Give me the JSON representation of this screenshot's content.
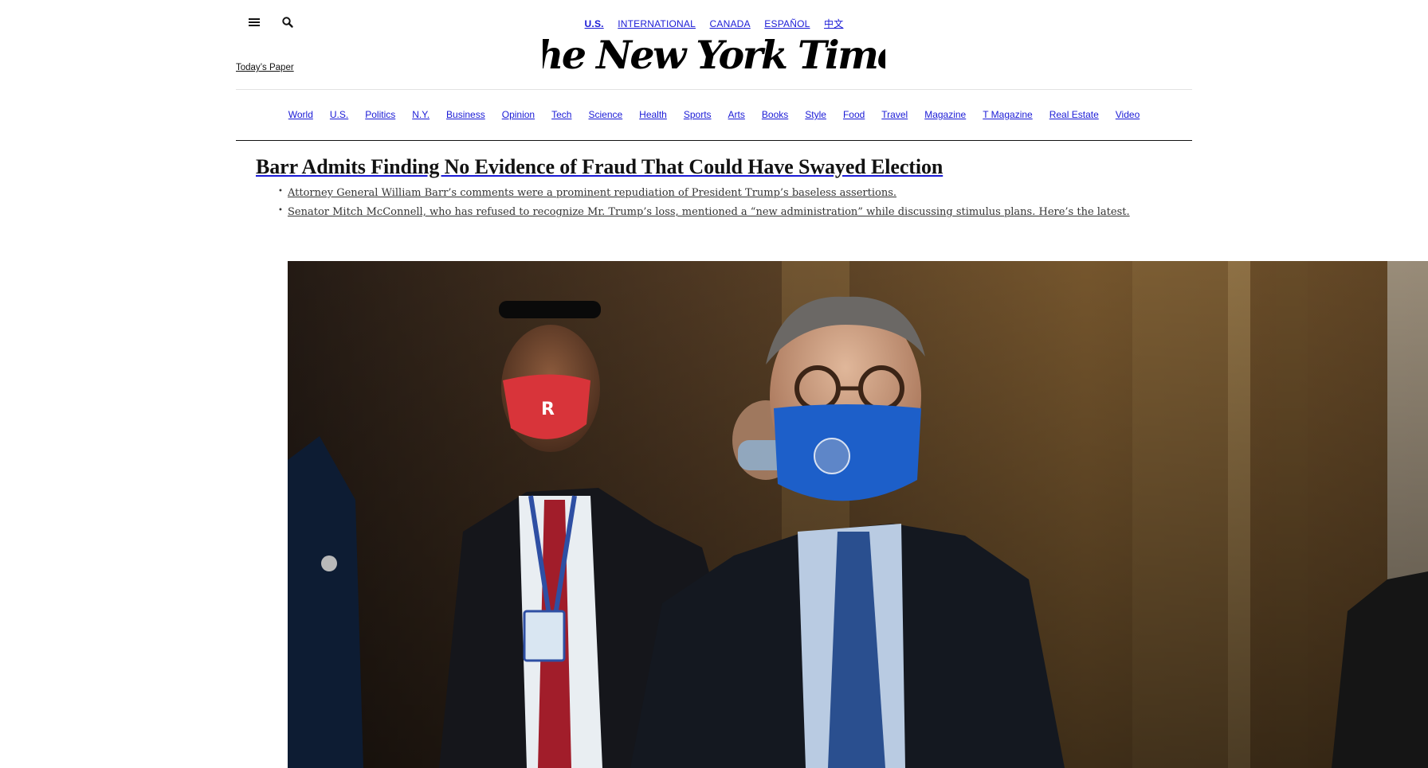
{
  "header": {
    "editions": [
      {
        "label": "U.S.",
        "active": true
      },
      {
        "label": "INTERNATIONAL",
        "active": false
      },
      {
        "label": "CANADA",
        "active": false
      },
      {
        "label": "ESPAÑOL",
        "active": false
      },
      {
        "label": "中文",
        "active": false
      }
    ],
    "todays_paper": "Today’s Paper",
    "logo_text": "The New York Times",
    "menu_icon": "hamburger-menu-icon",
    "search_icon": "search-icon"
  },
  "sections": [
    "World",
    "U.S.",
    "Politics",
    "N.Y.",
    "Business",
    "Opinion",
    "Tech",
    "Science",
    "Health",
    "Sports",
    "Arts",
    "Books",
    "Style",
    "Food",
    "Travel",
    "Magazine",
    "T Magazine",
    "Real Estate",
    "Video"
  ],
  "lead_story": {
    "headline": "Barr Admits Finding No Evidence of Fraud That Could Have Swayed Election",
    "bullets": [
      "Attorney General William Barr’s comments were a prominent repudiation of President Trump’s baseless assertions.",
      "Senator Mitch McConnell, who has refused to recognize Mr. Trump’s loss, mentioned a “new administration” while discussing stimulus plans. Here’s the latest."
    ]
  },
  "colors": {
    "link": "#1a1ad6",
    "text": "#121212",
    "summary_text": "#333333",
    "mask_blue": "#1d5fc9",
    "mask_red": "#d8343a"
  }
}
